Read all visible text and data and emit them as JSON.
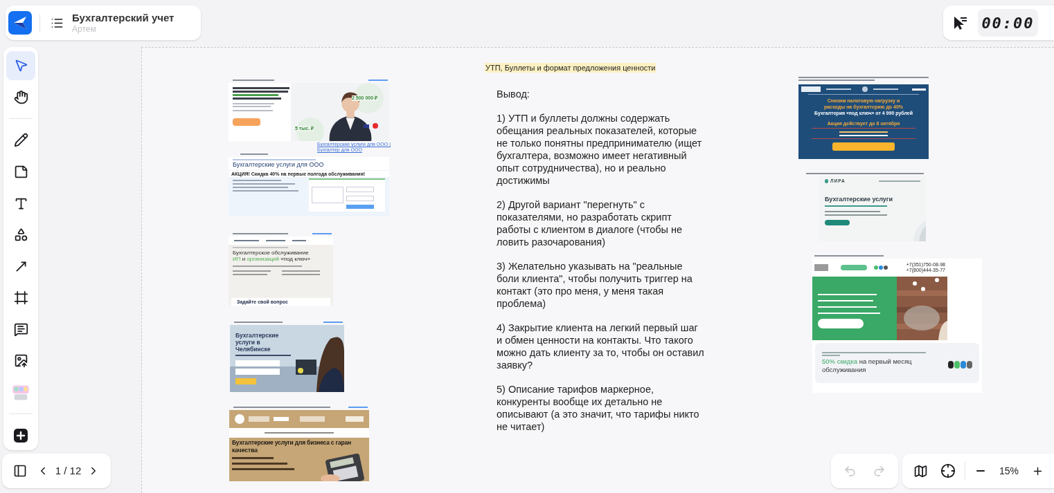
{
  "header": {
    "title": "Бухгалтерский учет",
    "owner": "Артем"
  },
  "timer": "00:00",
  "tools": [
    {
      "kind": "select",
      "selected": true
    },
    {
      "kind": "hand",
      "selected": false
    },
    {
      "kind": "pen",
      "selected": false
    },
    {
      "kind": "sticky",
      "selected": false
    },
    {
      "kind": "text",
      "selected": false
    },
    {
      "kind": "shapes",
      "selected": false
    },
    {
      "kind": "arrow",
      "selected": false
    },
    {
      "kind": "frame",
      "selected": false
    },
    {
      "kind": "comment",
      "selected": false
    },
    {
      "kind": "upload",
      "selected": false
    },
    {
      "kind": "stickers",
      "selected": false
    },
    {
      "kind": "add",
      "selected": false
    }
  ],
  "pager": "1 / 12",
  "history": {
    "undo_disabled": true,
    "redo_disabled": true
  },
  "zoom": "15%",
  "note": {
    "heading": "УТП, Буллеты и формат предложения ценности",
    "title": "Вывод:",
    "points": [
      "1) УТП и буллеты должны содержать обещания реальных показателей, которые не только понятны предпринимателю (ищет бухгалтера, возможно имеет негативный опыт сотрудничества), но и реально достижимы",
      "2) Другой вариант \"перегнуть\" с показателями, но разработать скрипт работы с клиентом в диалоге (чтобы не ловить разочарования)",
      "3) Желательно указывать на \"реальные боли клиента\", чтобы получить триггер на контакт (это про меня, у меня такая проблема)",
      "4) Закрытие клиента на легкий первый шаг и обмен ценности на контакты. Что такого можно дать клиенту за то, чтобы он оставил заявку?",
      "5) Описание тарифов маркерное, конкуренты вообще их детально не описывают (а это значит, что тарифы никто не читает)"
    ]
  },
  "screenshots": [
    {
      "kind": "hero",
      "value_1": "2 500 000 ₽",
      "value_2": "5 тыс. ₽"
    },
    {
      "kind": "llc",
      "link": "Бухгалтерские услуги для ООО | Бухгалтер для ООО",
      "title": "Бухгалтерские услуги для ООО",
      "promo": "АКЦИЯ! Скидка 40% на первые полгода обслуживания!"
    },
    {
      "kind": "turnkey",
      "title": [
        {
          "text": "Бухгалтерское обслуживание ",
          "accent": false
        },
        {
          "text": "ИП",
          "accent": true
        },
        {
          "text": " и ",
          "accent": false
        },
        {
          "text": "организаций",
          "accent": true
        },
        {
          "text": " «под ключ»",
          "accent": false
        }
      ],
      "cta": "Задайте свой вопрос"
    },
    {
      "kind": "city",
      "title": "Бухгалтерские услуги в Челябинске"
    },
    {
      "kind": "guarantee",
      "title": "Бухгалтерские услуги для бизнеса с гаран",
      "subtitle": "качества"
    },
    {
      "kind": "banner",
      "line_1": "Снизим налоговую нагрузку и",
      "line_2": "расходы на бухгалтерию до 40%",
      "line_3": "Бухгалтерия «под ключ» от 4 990 рублей",
      "line_4": "Акция действует до 8 октября"
    },
    {
      "kind": "brand",
      "logo": "ЛИРА",
      "title": "Бухгалтерские услуги"
    },
    {
      "kind": "discount",
      "phone_1": "+7(351)750-08-98",
      "phone_2": "+7(800)444-35-77",
      "accent": "50% скидка",
      "rest": " на первый месяц обслуживания"
    }
  ]
}
